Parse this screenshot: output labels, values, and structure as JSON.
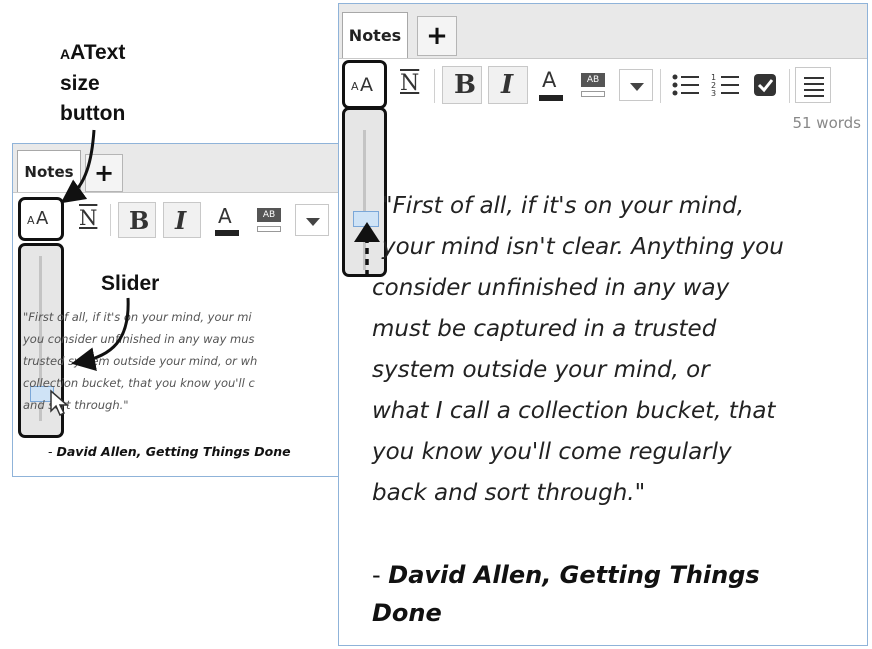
{
  "annotations": {
    "aa_small": "A",
    "aa_big": "AText",
    "line2": "size",
    "line3": "button",
    "slider": "Slider"
  },
  "small_panel": {
    "tab_label": "Notes",
    "add_tab": "+",
    "aa_small": "A",
    "aa_big": "A",
    "underline_btn": "N",
    "bold_btn": "B",
    "italic_btn": "I",
    "color_btn": "A",
    "highlight_btn": "AB",
    "quote_lines": [
      "\"First of all, if it's on your mind, your mi",
      "you consider unfinished in any way mus",
      "trusted system outside your mind, or wh",
      "collection bucket, that you know you'll c",
      "and sort through.\""
    ],
    "author_dash": "- ",
    "author": "David Allen, Getting Things Done"
  },
  "big_panel": {
    "tab_label": "Notes",
    "add_tab": "+",
    "aa_small": "A",
    "aa_big": "A",
    "underline_btn": "N",
    "bold_btn": "B",
    "italic_btn": "I",
    "color_btn": "A",
    "highlight_btn": "AB",
    "word_count": "51 words",
    "quote_lines": [
      "\"First of all, if it's on your mind,",
      "your mind isn't clear. Anything you",
      "consider unfinished in any way",
      "must be captured in a trusted",
      "system outside your mind, or",
      "what I call a collection bucket, that",
      "you know you'll come regularly",
      "back and sort through.\""
    ],
    "author_dash": "- ",
    "author_line1": "David Allen, Getting Things",
    "author_line2": "Done"
  }
}
